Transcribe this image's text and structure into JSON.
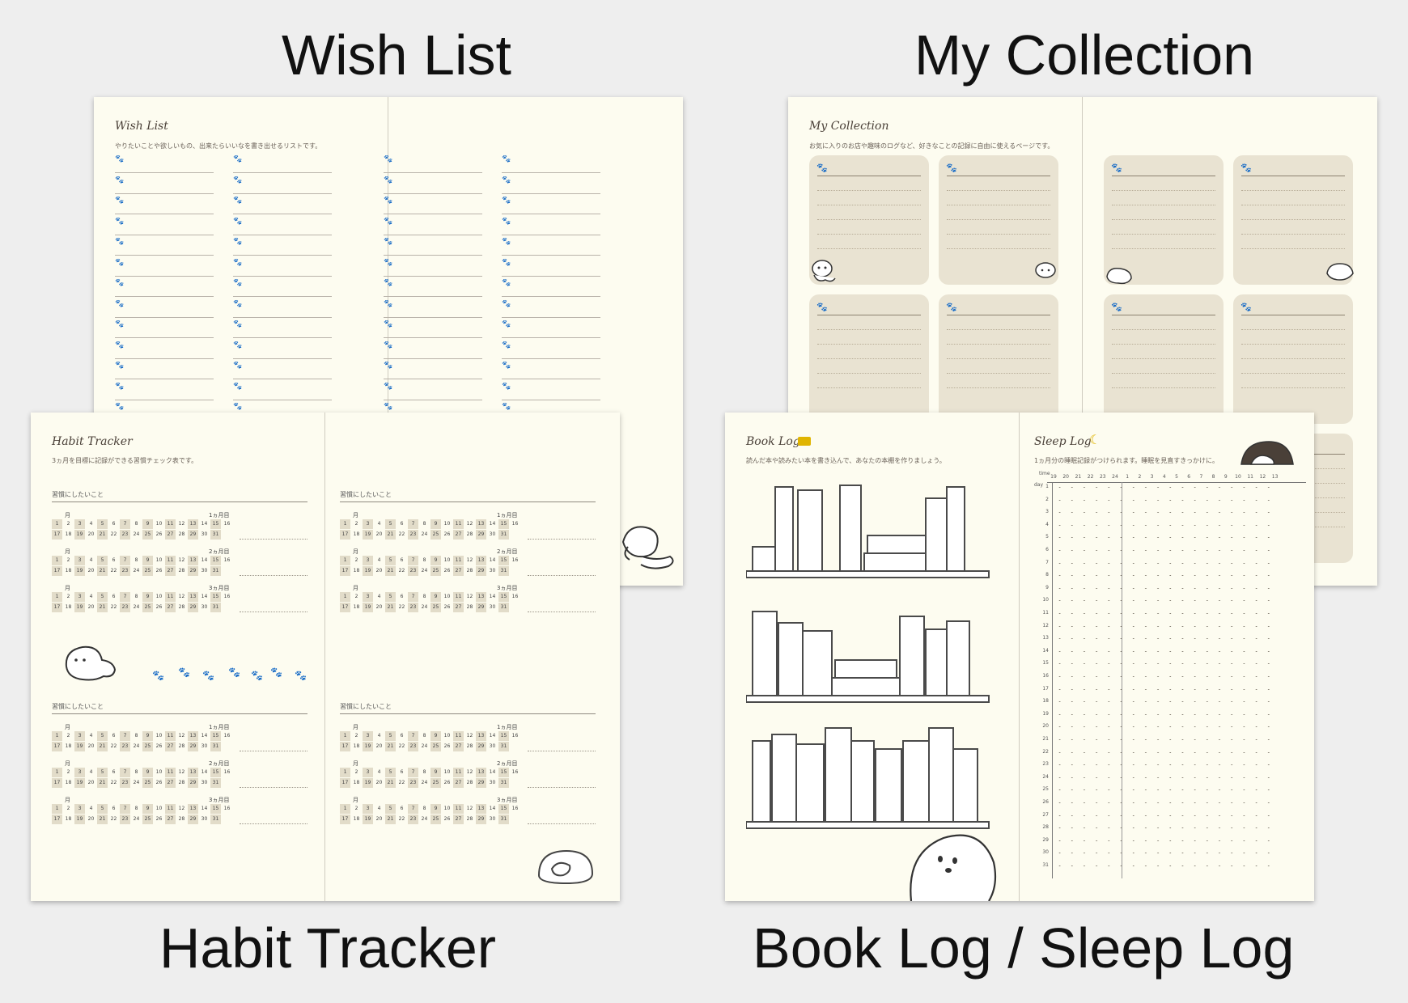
{
  "captions": {
    "wish_list": "Wish List",
    "my_collection": "My Collection",
    "habit_tracker": "Habit Tracker",
    "book_sleep": "Book Log / Sleep Log"
  },
  "wish_list_page": {
    "title": "Wish List",
    "subtitle": "やりたいことや欲しいもの、出来たらいいなを書き出せるリストです。"
  },
  "collection_page": {
    "title": "My Collection",
    "subtitle": "お気に入りのお店や趣味のログなど、好きなことの記録に自由に使えるページです。"
  },
  "habit_page": {
    "title": "Habit Tracker",
    "subtitle": "3ヵ月を目標に記録ができる習慣チェック表です。",
    "section_label": "習慣にしたいこと",
    "month_label": "月",
    "month_count_labels": [
      "1ヵ月目",
      "2ヵ月目",
      "3ヵ月目"
    ]
  },
  "book_page": {
    "title": "Book Log",
    "subtitle": "読んだ本や読みたい本を書き込んで、あなたの本棚を作りましょう。"
  },
  "sleep_page": {
    "title": "Sleep Log",
    "subtitle": "1ヵ月分の睡眠記録がつけられます。睡眠を見直すきっかけに。",
    "time_label": "time",
    "day_label": "day",
    "hours": [
      "19",
      "20",
      "21",
      "22",
      "23",
      "24",
      "1",
      "2",
      "3",
      "4",
      "5",
      "6",
      "7",
      "8",
      "9",
      "10",
      "11",
      "12",
      "13"
    ]
  },
  "colors": {
    "background": "#eeeeee",
    "paper": "#fdfcf0",
    "card": "#e9e3d2",
    "ink": "#4a4038",
    "accent": "#e0b400"
  },
  "icons": [
    "paw-icon",
    "book-icon",
    "moon-icon",
    "dog-illustration",
    "bookshelf-illustration"
  ]
}
